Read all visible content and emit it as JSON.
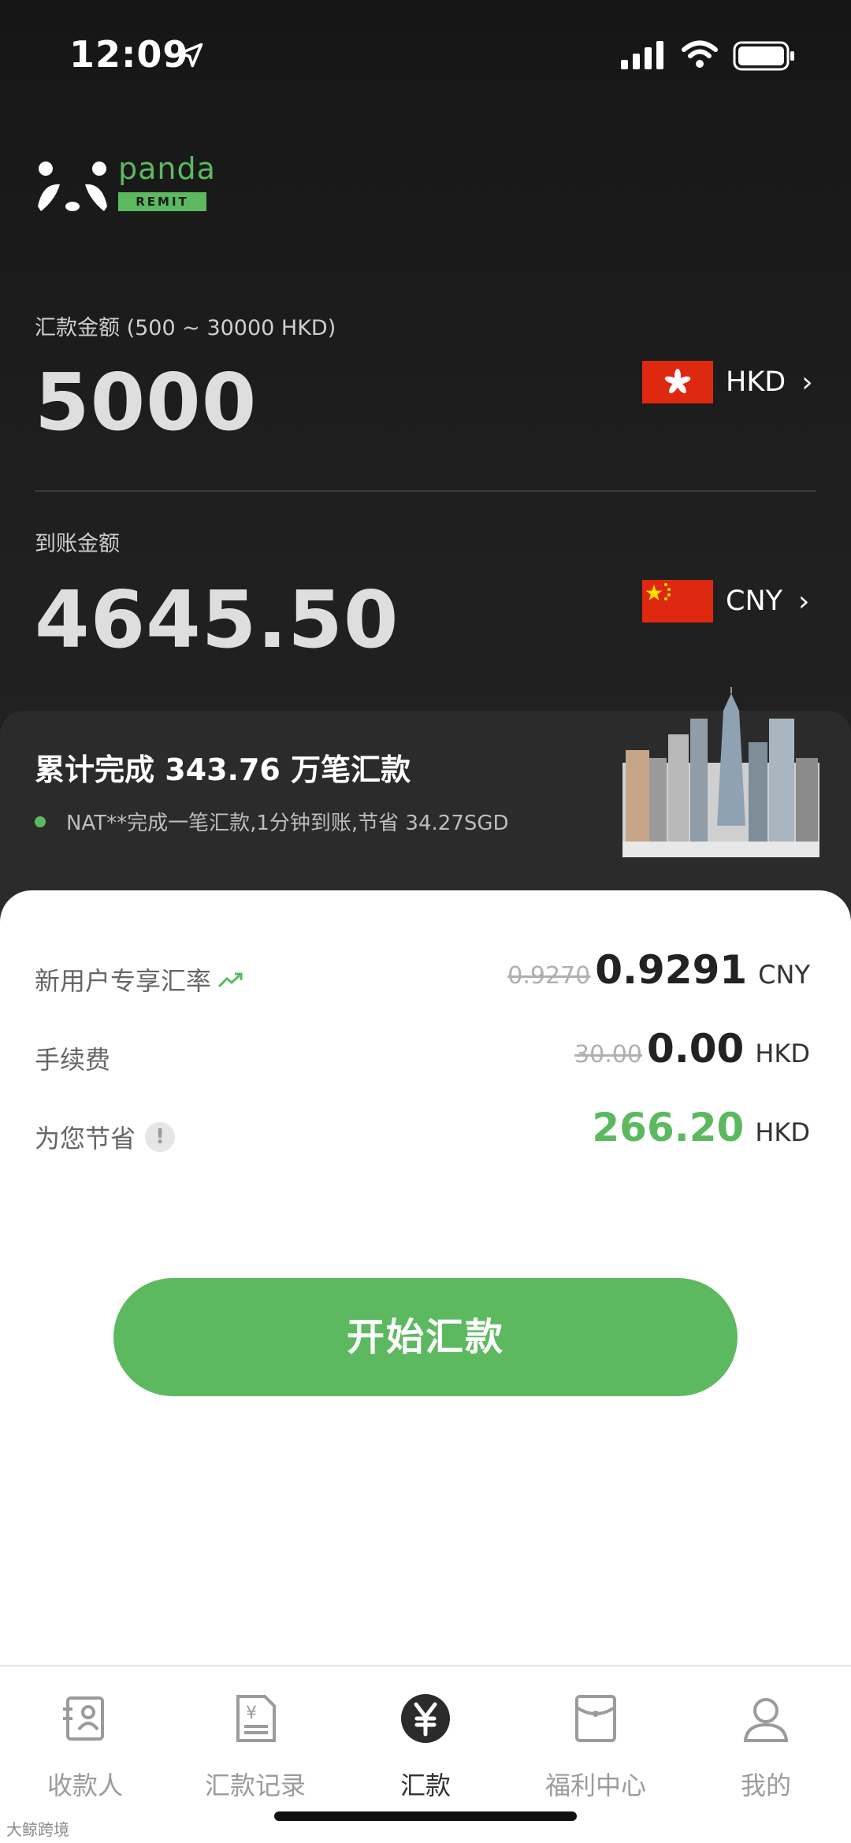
{
  "status_bar": {
    "time": "12:09"
  },
  "brand": {
    "name": "panda",
    "tag": "REMIT",
    "color": "#5db960"
  },
  "send": {
    "label": "汇款金额 (500 ~ 30000 HKD)",
    "amount": "5000",
    "currency": "HKD"
  },
  "receive": {
    "label": "到账金额",
    "amount": "4645.50",
    "currency": "CNY"
  },
  "stats": {
    "title": "累计完成 343.76 万笔汇款",
    "ticker": "NAT**完成一笔汇款,1分钟到账,节省 34.27SGD"
  },
  "rates": {
    "rate": {
      "label": "新用户专享汇率",
      "old": "0.9270",
      "value": "0.9291",
      "unit": "CNY"
    },
    "fee": {
      "label": "手续费",
      "old": "30.00",
      "value": "0.00",
      "unit": "HKD"
    },
    "save": {
      "label": "为您节省",
      "info": "!",
      "value": "266.20",
      "unit": "HKD"
    }
  },
  "cta": {
    "label": "开始汇款"
  },
  "tabs": [
    {
      "label": "收款人",
      "icon": "contact-card-icon"
    },
    {
      "label": "汇款记录",
      "icon": "receipt-icon"
    },
    {
      "label": "汇款",
      "icon": "yen-icon",
      "active": true
    },
    {
      "label": "福利中心",
      "icon": "gift-envelope-icon"
    },
    {
      "label": "我的",
      "icon": "profile-icon"
    }
  ],
  "watermark": "大鲸跨境"
}
